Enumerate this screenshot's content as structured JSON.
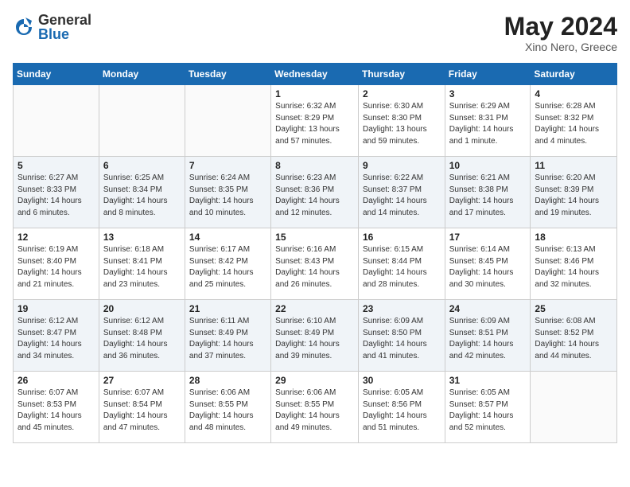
{
  "header": {
    "logo_general": "General",
    "logo_blue": "Blue",
    "title": "May 2024",
    "location": "Xino Nero, Greece"
  },
  "days_of_week": [
    "Sunday",
    "Monday",
    "Tuesday",
    "Wednesday",
    "Thursday",
    "Friday",
    "Saturday"
  ],
  "weeks": [
    [
      {
        "day": "",
        "info": ""
      },
      {
        "day": "",
        "info": ""
      },
      {
        "day": "",
        "info": ""
      },
      {
        "day": "1",
        "info": "Sunrise: 6:32 AM\nSunset: 8:29 PM\nDaylight: 13 hours\nand 57 minutes."
      },
      {
        "day": "2",
        "info": "Sunrise: 6:30 AM\nSunset: 8:30 PM\nDaylight: 13 hours\nand 59 minutes."
      },
      {
        "day": "3",
        "info": "Sunrise: 6:29 AM\nSunset: 8:31 PM\nDaylight: 14 hours\nand 1 minute."
      },
      {
        "day": "4",
        "info": "Sunrise: 6:28 AM\nSunset: 8:32 PM\nDaylight: 14 hours\nand 4 minutes."
      }
    ],
    [
      {
        "day": "5",
        "info": "Sunrise: 6:27 AM\nSunset: 8:33 PM\nDaylight: 14 hours\nand 6 minutes."
      },
      {
        "day": "6",
        "info": "Sunrise: 6:25 AM\nSunset: 8:34 PM\nDaylight: 14 hours\nand 8 minutes."
      },
      {
        "day": "7",
        "info": "Sunrise: 6:24 AM\nSunset: 8:35 PM\nDaylight: 14 hours\nand 10 minutes."
      },
      {
        "day": "8",
        "info": "Sunrise: 6:23 AM\nSunset: 8:36 PM\nDaylight: 14 hours\nand 12 minutes."
      },
      {
        "day": "9",
        "info": "Sunrise: 6:22 AM\nSunset: 8:37 PM\nDaylight: 14 hours\nand 14 minutes."
      },
      {
        "day": "10",
        "info": "Sunrise: 6:21 AM\nSunset: 8:38 PM\nDaylight: 14 hours\nand 17 minutes."
      },
      {
        "day": "11",
        "info": "Sunrise: 6:20 AM\nSunset: 8:39 PM\nDaylight: 14 hours\nand 19 minutes."
      }
    ],
    [
      {
        "day": "12",
        "info": "Sunrise: 6:19 AM\nSunset: 8:40 PM\nDaylight: 14 hours\nand 21 minutes."
      },
      {
        "day": "13",
        "info": "Sunrise: 6:18 AM\nSunset: 8:41 PM\nDaylight: 14 hours\nand 23 minutes."
      },
      {
        "day": "14",
        "info": "Sunrise: 6:17 AM\nSunset: 8:42 PM\nDaylight: 14 hours\nand 25 minutes."
      },
      {
        "day": "15",
        "info": "Sunrise: 6:16 AM\nSunset: 8:43 PM\nDaylight: 14 hours\nand 26 minutes."
      },
      {
        "day": "16",
        "info": "Sunrise: 6:15 AM\nSunset: 8:44 PM\nDaylight: 14 hours\nand 28 minutes."
      },
      {
        "day": "17",
        "info": "Sunrise: 6:14 AM\nSunset: 8:45 PM\nDaylight: 14 hours\nand 30 minutes."
      },
      {
        "day": "18",
        "info": "Sunrise: 6:13 AM\nSunset: 8:46 PM\nDaylight: 14 hours\nand 32 minutes."
      }
    ],
    [
      {
        "day": "19",
        "info": "Sunrise: 6:12 AM\nSunset: 8:47 PM\nDaylight: 14 hours\nand 34 minutes."
      },
      {
        "day": "20",
        "info": "Sunrise: 6:12 AM\nSunset: 8:48 PM\nDaylight: 14 hours\nand 36 minutes."
      },
      {
        "day": "21",
        "info": "Sunrise: 6:11 AM\nSunset: 8:49 PM\nDaylight: 14 hours\nand 37 minutes."
      },
      {
        "day": "22",
        "info": "Sunrise: 6:10 AM\nSunset: 8:49 PM\nDaylight: 14 hours\nand 39 minutes."
      },
      {
        "day": "23",
        "info": "Sunrise: 6:09 AM\nSunset: 8:50 PM\nDaylight: 14 hours\nand 41 minutes."
      },
      {
        "day": "24",
        "info": "Sunrise: 6:09 AM\nSunset: 8:51 PM\nDaylight: 14 hours\nand 42 minutes."
      },
      {
        "day": "25",
        "info": "Sunrise: 6:08 AM\nSunset: 8:52 PM\nDaylight: 14 hours\nand 44 minutes."
      }
    ],
    [
      {
        "day": "26",
        "info": "Sunrise: 6:07 AM\nSunset: 8:53 PM\nDaylight: 14 hours\nand 45 minutes."
      },
      {
        "day": "27",
        "info": "Sunrise: 6:07 AM\nSunset: 8:54 PM\nDaylight: 14 hours\nand 47 minutes."
      },
      {
        "day": "28",
        "info": "Sunrise: 6:06 AM\nSunset: 8:55 PM\nDaylight: 14 hours\nand 48 minutes."
      },
      {
        "day": "29",
        "info": "Sunrise: 6:06 AM\nSunset: 8:55 PM\nDaylight: 14 hours\nand 49 minutes."
      },
      {
        "day": "30",
        "info": "Sunrise: 6:05 AM\nSunset: 8:56 PM\nDaylight: 14 hours\nand 51 minutes."
      },
      {
        "day": "31",
        "info": "Sunrise: 6:05 AM\nSunset: 8:57 PM\nDaylight: 14 hours\nand 52 minutes."
      },
      {
        "day": "",
        "info": ""
      }
    ]
  ]
}
